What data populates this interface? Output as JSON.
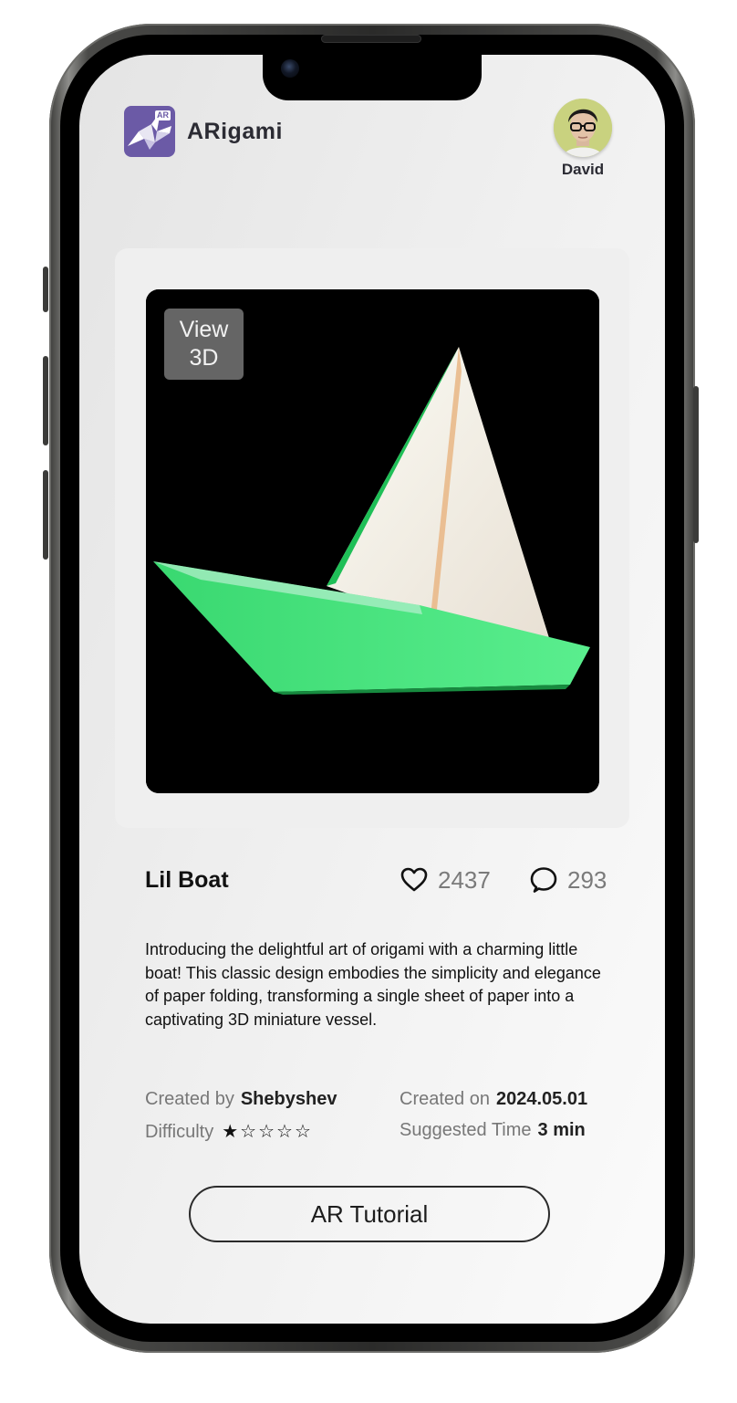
{
  "app": {
    "name": "ARigami",
    "logo_badge": "AR",
    "brand_color": "#6b5aa6"
  },
  "user": {
    "name": "David",
    "avatar_background": "#c9d27f"
  },
  "preview": {
    "view_3d_line1": "View",
    "view_3d_line2": "3D",
    "icon": "origami-boat-photo"
  },
  "item": {
    "title": "Lil Boat",
    "likes": "2437",
    "like_icon": "heart-icon",
    "comments": "293",
    "comment_icon": "comment-bubble-icon",
    "description": "Introducing the delightful art of origami with a charming little boat! This classic design embodies the simplicity and elegance of paper folding, transforming a single sheet of paper into a captivating 3D miniature vessel."
  },
  "details": {
    "created_by_label": "Created by",
    "created_by_value": "Shebyshev",
    "created_on_label": "Created on",
    "created_on_value": "2024.05.01",
    "difficulty_label": "Difficulty",
    "difficulty_rating": 1,
    "difficulty_max": 5,
    "difficulty_stars": "★☆☆☆☆",
    "suggested_time_label": "Suggested Time",
    "suggested_time_value": "3 min"
  },
  "actions": {
    "ar_tutorial_label": "AR Tutorial"
  }
}
